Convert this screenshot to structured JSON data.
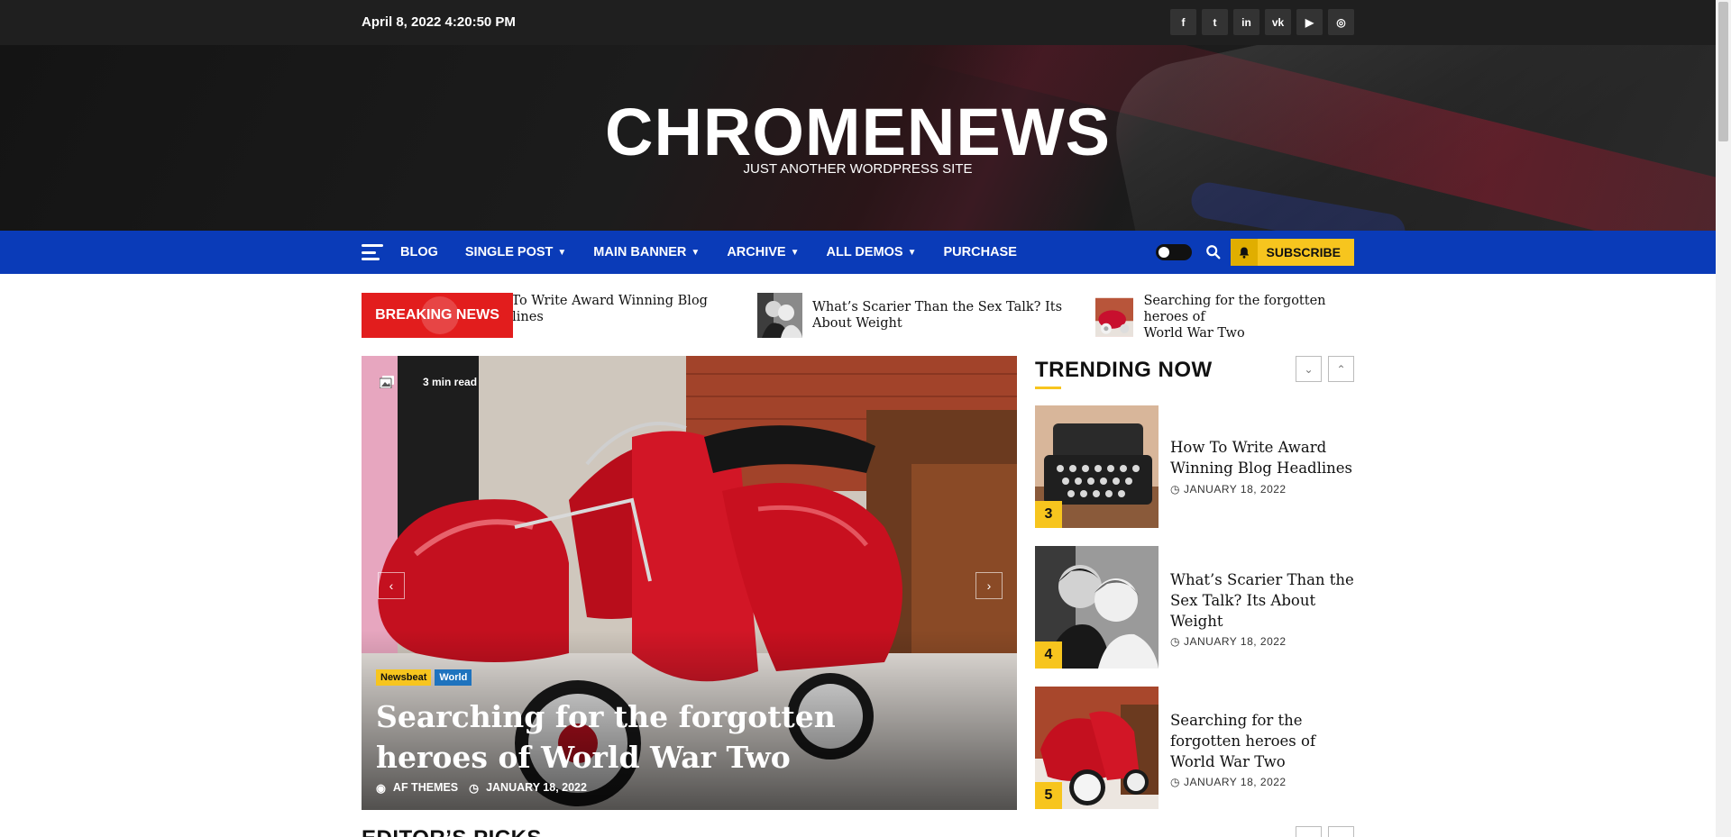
{
  "topbar": {
    "datetime": "April 8, 2022 4:20:50 PM",
    "social": [
      {
        "icon": "facebook-icon",
        "glyph": "f"
      },
      {
        "icon": "twitter-icon",
        "glyph": "t"
      },
      {
        "icon": "linkedin-icon",
        "glyph": "in"
      },
      {
        "icon": "vk-icon",
        "glyph": "vk"
      },
      {
        "icon": "youtube-icon",
        "glyph": "▶"
      },
      {
        "icon": "instagram-icon",
        "glyph": "◎"
      }
    ]
  },
  "masthead": {
    "title": "CHROMENEWS",
    "tagline": "JUST ANOTHER WORDPRESS SITE"
  },
  "nav": {
    "items": [
      {
        "label": "BLOG",
        "dropdown": false
      },
      {
        "label": "SINGLE POST",
        "dropdown": true
      },
      {
        "label": "MAIN BANNER",
        "dropdown": true
      },
      {
        "label": "ARCHIVE",
        "dropdown": true
      },
      {
        "label": "ALL DEMOS",
        "dropdown": true
      },
      {
        "label": "PURCHASE",
        "dropdown": false
      }
    ],
    "subscribe_label": "SUBSCRIBE"
  },
  "breaking": {
    "label": "BREAKING NEWS",
    "items": [
      {
        "title_line1": "How To Write Award Winning Blog",
        "title_line2": "Headlines"
      },
      {
        "title_line1": "What’s Scarier Than the Sex Talk? Its",
        "title_line2": "About Weight"
      },
      {
        "title_line1": "Searching for the forgotten heroes of",
        "title_line2": "World War Two"
      }
    ]
  },
  "hero": {
    "read_time": "3 min read",
    "tags": [
      {
        "label": "Newsbeat",
        "bg": "#f7c51e",
        "fg": "#111111"
      },
      {
        "label": "World",
        "bg": "#1e73be",
        "fg": "#ffffff"
      }
    ],
    "title": "Searching for the forgotten heroes of World War Two",
    "author": "AF THEMES",
    "date": "JANUARY 18, 2022"
  },
  "trending": {
    "heading": "TRENDING NOW",
    "items": [
      {
        "rank": "3",
        "title": "How To Write Award Winning Blog Headlines",
        "date": "JANUARY 18, 2022"
      },
      {
        "rank": "4",
        "title": "What’s Scarier Than the Sex Talk? Its About Weight",
        "date": "JANUARY 18, 2022"
      },
      {
        "rank": "5",
        "title": "Searching for the forgotten heroes of World War Two",
        "date": "JANUARY 18, 2022"
      }
    ]
  },
  "editors": {
    "heading": "EDITOR’S PICKS"
  },
  "colors": {
    "topbar": "#1f1f1f",
    "nav": "#0a3bb8",
    "accent_yellow": "#f7c51e",
    "breaking_red": "#e21d1d"
  }
}
